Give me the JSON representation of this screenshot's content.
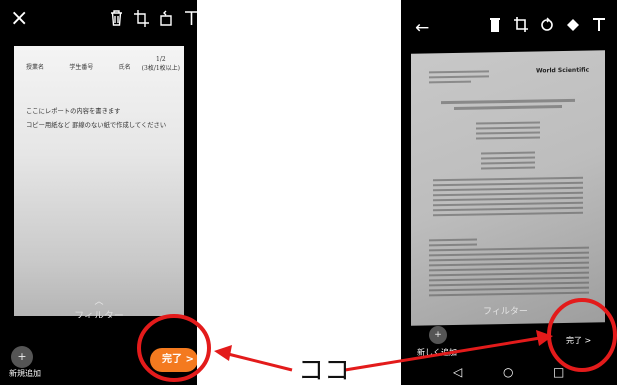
{
  "left_phone": {
    "close_icon": "×",
    "tools": [
      "trash-icon",
      "crop-icon",
      "rotate-icon",
      "text-icon",
      "pen-icon"
    ],
    "doc": {
      "header": [
        "授業名",
        "学生番号",
        "氏名"
      ],
      "fraction": "1/2",
      "fraction_note": "(3枚/1枚以上)",
      "line1": "ここにレポートの内容を書きます",
      "line2": "コピー用紙など 罫線のない紙で作成してください"
    },
    "filter_label": "フィルター",
    "filter_chevron": "︿",
    "add_label": "新規追加",
    "done_label": "完了 >"
  },
  "right_phone": {
    "back_icon": "←",
    "tools": [
      "trash-icon",
      "crop-icon",
      "rotate-icon",
      "palette-icon",
      "text-icon",
      "pen-icon"
    ],
    "publisher": "World Scientific",
    "filter_label": "フィルター",
    "add_label": "新しく追加",
    "done_label": "完了 >",
    "nav": [
      "◁",
      "○",
      "□"
    ]
  },
  "annotation": {
    "label": "ココ",
    "color": "#e31b1b"
  }
}
